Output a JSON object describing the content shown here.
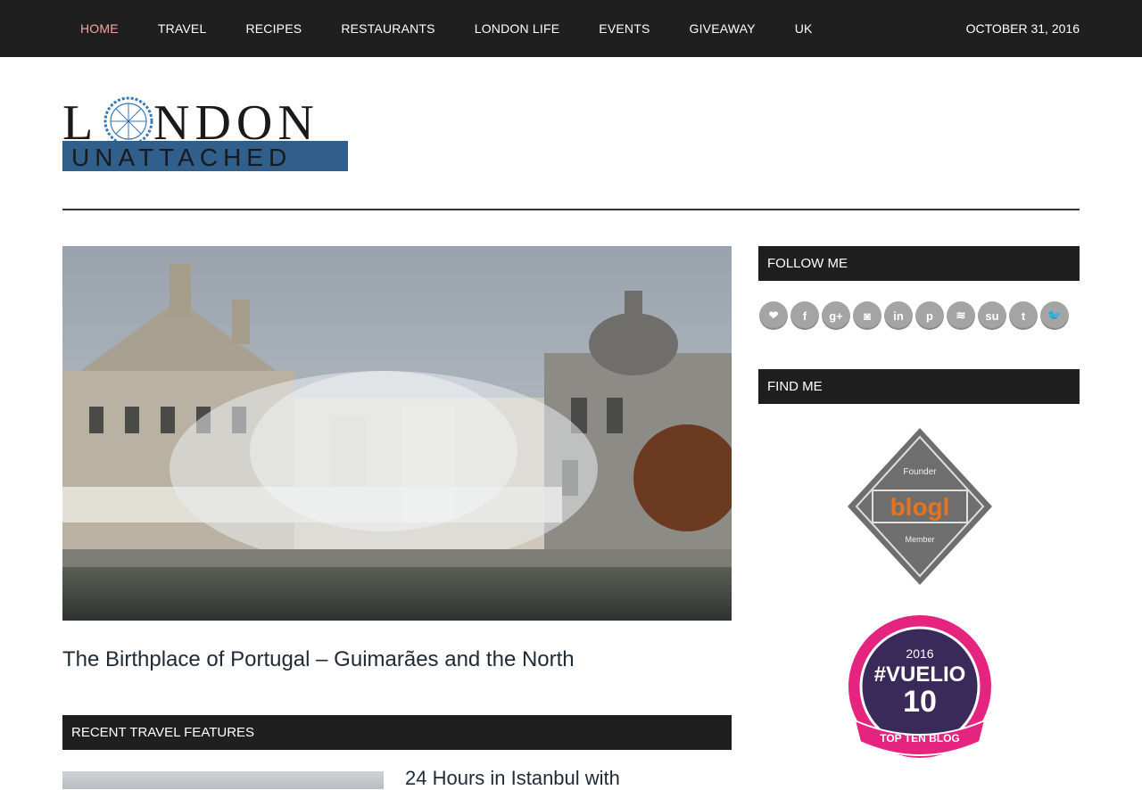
{
  "nav": {
    "items": [
      {
        "label": "HOME",
        "active": true
      },
      {
        "label": "TRAVEL"
      },
      {
        "label": "RECIPES"
      },
      {
        "label": "RESTAURANTS"
      },
      {
        "label": "LONDON LIFE"
      },
      {
        "label": "EVENTS"
      },
      {
        "label": "GIVEAWAY"
      },
      {
        "label": "UK"
      }
    ],
    "date": "OCTOBER 31, 2016",
    "active_color": "#f4a6a6"
  },
  "logo": {
    "line1": "LONDON",
    "line2": "UNATTACHED",
    "accent_color": "#3a77b5",
    "bar_color": "#2f5f8a"
  },
  "main": {
    "featured_title": "The Birthplace of Portugal – Guimarães and the North",
    "section_heading": "RECENT TRAVEL FEATURES",
    "recent_title": "24 Hours in Istanbul with"
  },
  "sidebar": {
    "follow_heading": "FOLLOW ME",
    "social_icons": [
      "bloglovin-heart-icon",
      "facebook-icon",
      "google-plus-icon",
      "instagram-icon",
      "linkedin-icon",
      "pinterest-icon",
      "rss-icon",
      "stumbleupon-icon",
      "tumblr-icon",
      "twitter-icon"
    ],
    "social_glyphs": [
      "❤",
      "f",
      "g+",
      "◙",
      "in",
      "p",
      "≋",
      "su",
      "t",
      "🐦"
    ],
    "find_heading": "FIND ME",
    "badge1": {
      "top": "Founder",
      "middle": "blogl",
      "bottom": "Member",
      "accent": "#e8731f"
    },
    "badge2": {
      "year": "2016",
      "name": "#VUELIO",
      "number": "10",
      "ribbon": "TOP TEN BLOG",
      "accent": "#e4247f",
      "inner": "#3a2a5a"
    }
  }
}
